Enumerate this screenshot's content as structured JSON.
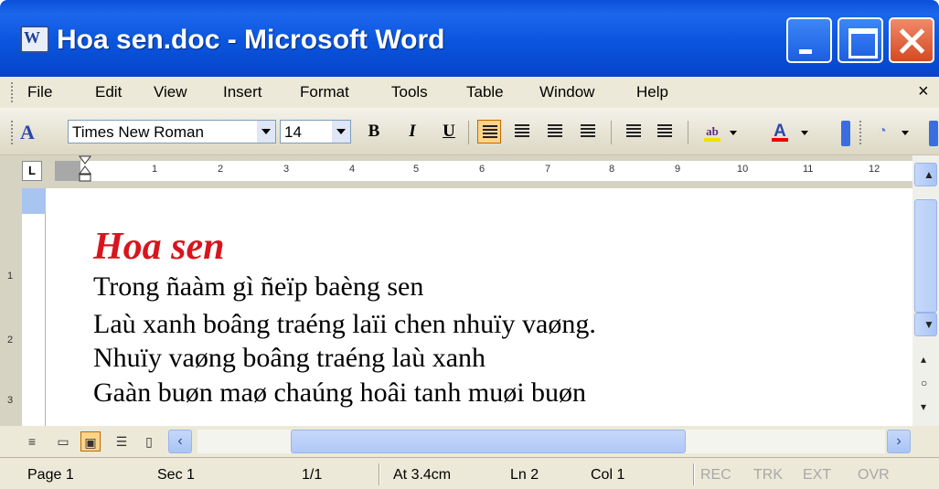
{
  "window": {
    "title": "Hoa sen.doc - Microsoft Word"
  },
  "menu": {
    "items": [
      "File",
      "Edit",
      "View",
      "Insert",
      "Format",
      "Tools",
      "Table",
      "Window",
      "Help"
    ],
    "close_glyph": "×"
  },
  "toolbar": {
    "style_icon": "A",
    "font_name": "Times New Roman",
    "font_size": "14",
    "bold": "B",
    "italic": "I",
    "underline": "U",
    "font_color_label": "A",
    "highlight_label": "ab",
    "active_alignment": "align-left"
  },
  "ruler": {
    "tab_selector": "L",
    "ticks": [
      "1",
      "2",
      "3",
      "4",
      "5",
      "6",
      "7",
      "8",
      "9",
      "10",
      "11",
      "12"
    ],
    "vertical_ticks": [
      "1",
      "2",
      "3"
    ]
  },
  "document": {
    "title": "Hoa sen",
    "title_color": "#d9141c",
    "lines": [
      "Trong ñaàm gì ñeïp baèng sen",
      "Laù xanh boâng traéng laïi chen nhuïy vaøng.",
      "Nhuïy vaøng boâng traéng laù xanh",
      "Gaàn buøn maø chaúng hoâi tanh muøi buøn"
    ]
  },
  "statusbar": {
    "page": "Page 1",
    "sec": "Sec 1",
    "pages": "1/1",
    "at": "At 3.4cm",
    "ln": "Ln 2",
    "col": "Col 1",
    "modes": [
      "REC",
      "TRK",
      "EXT",
      "OVR"
    ]
  },
  "colors": {
    "titlebar": "#0a55dd",
    "chrome": "#ece9d8",
    "active_button": "#fbd48a"
  }
}
